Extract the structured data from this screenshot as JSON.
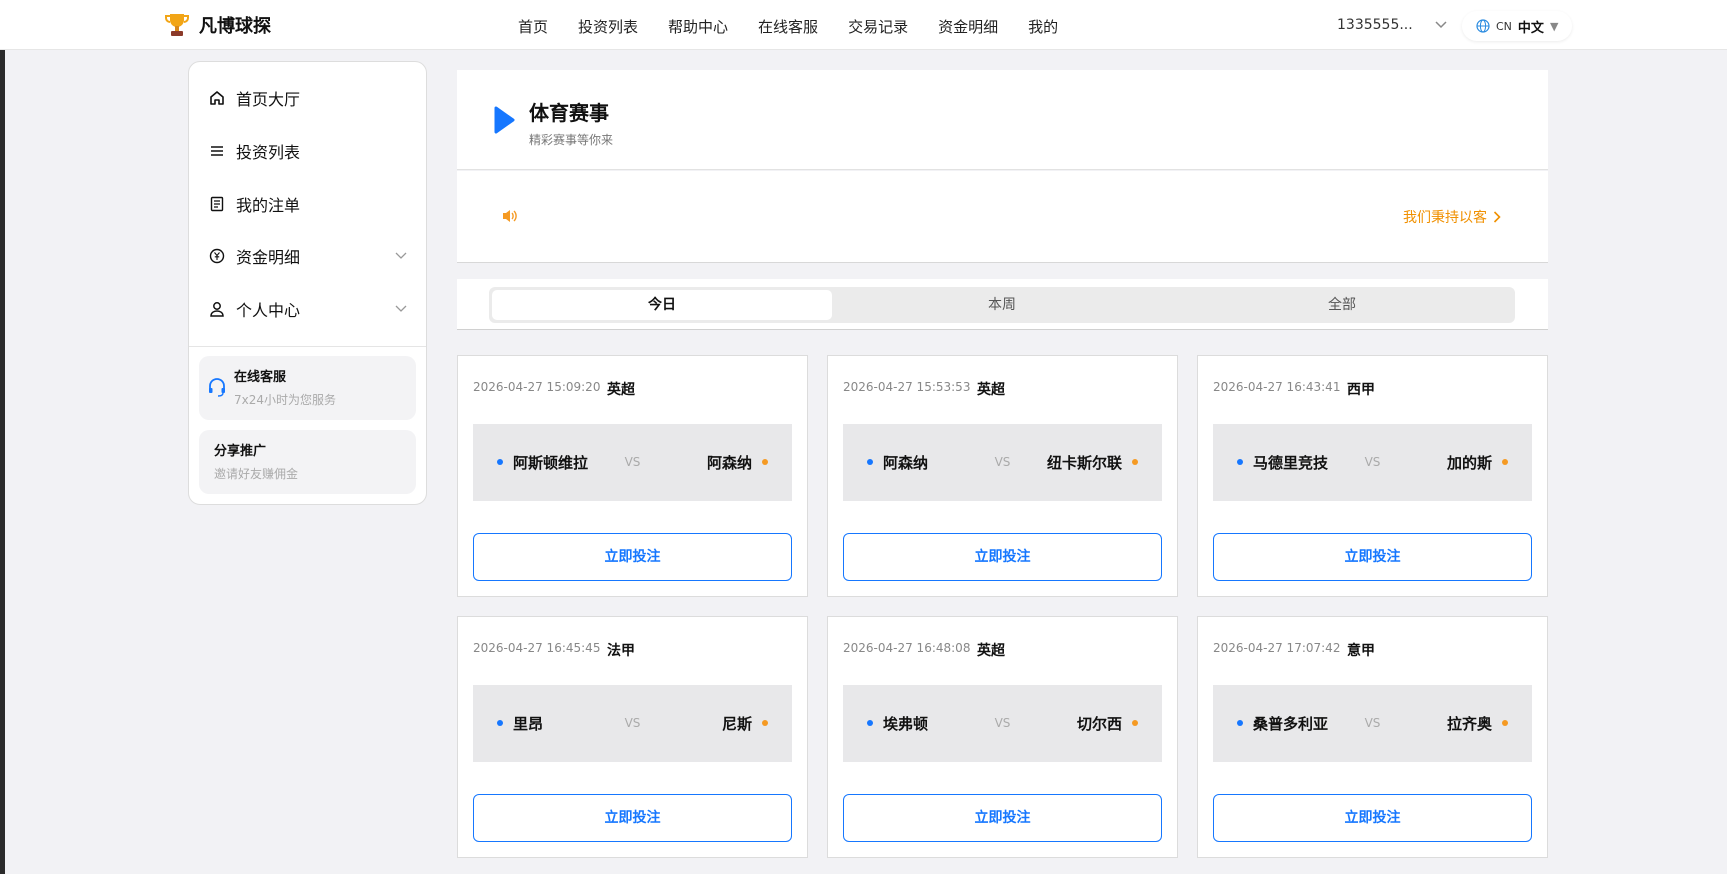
{
  "brand": {
    "name": "凡博球探"
  },
  "nav": [
    "首页",
    "投资列表",
    "帮助中心",
    "在线客服",
    "交易记录",
    "资金明细",
    "我的"
  ],
  "user": {
    "account": "1335555..."
  },
  "lang": {
    "code": "CN",
    "label": "中文"
  },
  "sidebar": {
    "items": [
      {
        "label": "首页大厅",
        "icon": "home-icon"
      },
      {
        "label": "投资列表",
        "icon": "list-icon"
      },
      {
        "label": "我的注单",
        "icon": "document-icon"
      },
      {
        "label": "资金明细",
        "icon": "yuan-icon",
        "expandable": true
      },
      {
        "label": "个人中心",
        "icon": "user-icon",
        "expandable": true
      }
    ],
    "cards": [
      {
        "title": "在线客服",
        "subtitle": "7x24小时为您服务",
        "icon": "headset-icon"
      },
      {
        "title": "分享推广",
        "subtitle": "邀请好友赚佣金"
      }
    ]
  },
  "main": {
    "title": "体育赛事",
    "subtitle": "精彩赛事等你来",
    "notice": "我们秉持以客",
    "tabs": [
      "今日",
      "本周",
      "全部"
    ],
    "active_tab": 0
  },
  "matches": [
    {
      "time": "2026-04-27 15:09:20",
      "league": "英超",
      "home": "阿斯顿维拉",
      "vs": "VS",
      "away": "阿森纳",
      "button": "立即投注"
    },
    {
      "time": "2026-04-27 15:53:53",
      "league": "英超",
      "home": "阿森纳",
      "vs": "VS",
      "away": "纽卡斯尔联",
      "button": "立即投注"
    },
    {
      "time": "2026-04-27 16:43:41",
      "league": "西甲",
      "home": "马德里竞技",
      "vs": "VS",
      "away": "加的斯",
      "button": "立即投注"
    },
    {
      "time": "2026-04-27 16:45:45",
      "league": "法甲",
      "home": "里昂",
      "vs": "VS",
      "away": "尼斯",
      "button": "立即投注"
    },
    {
      "time": "2026-04-27 16:48:08",
      "league": "英超",
      "home": "埃弗顿",
      "vs": "VS",
      "away": "切尔西",
      "button": "立即投注"
    },
    {
      "time": "2026-04-27 17:07:42",
      "league": "意甲",
      "home": "桑普多利亚",
      "vs": "VS",
      "away": "拉齐奥",
      "button": "立即投注"
    }
  ],
  "colors": {
    "accent": "#1677ff",
    "orange": "#f09000"
  }
}
